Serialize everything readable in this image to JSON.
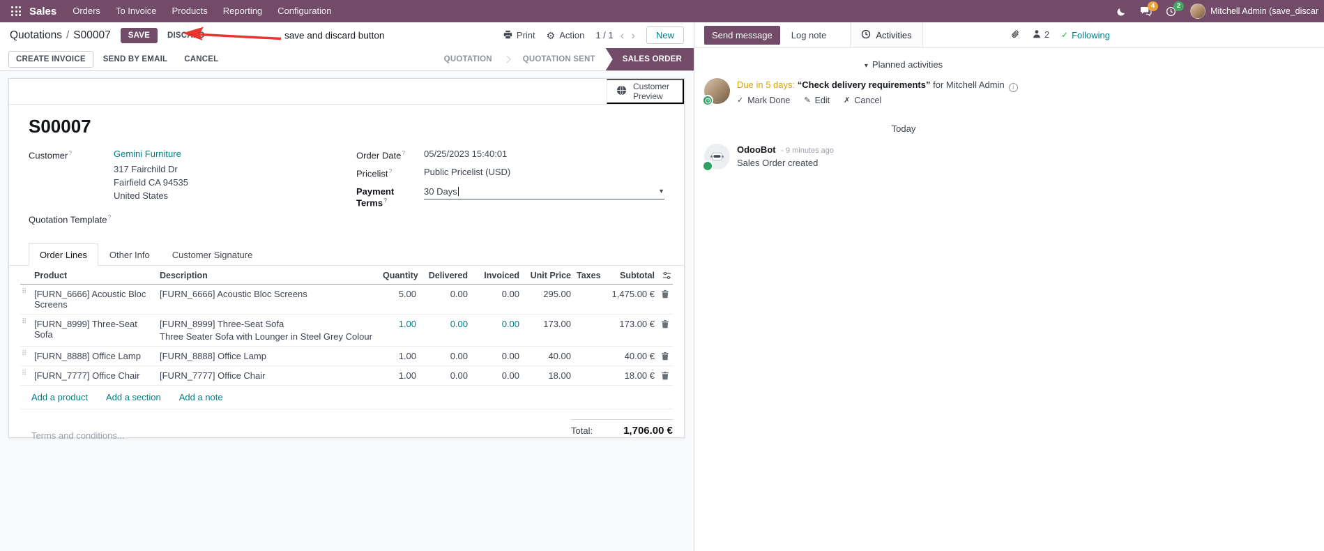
{
  "topbar": {
    "app": "Sales",
    "menus": [
      "Orders",
      "To Invoice",
      "Products",
      "Reporting",
      "Configuration"
    ],
    "message_badge": "4",
    "activity_badge": "2",
    "user_name": "Mitchell Admin (save_discar"
  },
  "control_panel": {
    "breadcrumb_parent": "Quotations",
    "breadcrumb_separator": "/",
    "breadcrumb_current": "S00007",
    "save": "SAVE",
    "discard": "DISCARD",
    "print": "Print",
    "action": "Action",
    "pager": "1 / 1",
    "new": "New"
  },
  "annotation": {
    "text": "save and discard button",
    "color": "#e8352e"
  },
  "statusbar": {
    "create_invoice": "CREATE INVOICE",
    "send_by_email": "SEND BY EMAIL",
    "cancel": "CANCEL",
    "stages": [
      "QUOTATION",
      "QUOTATION SENT",
      "SALES ORDER"
    ],
    "active_stage": "SALES ORDER"
  },
  "form": {
    "customer_preview": "Customer Preview",
    "name": "S00007",
    "customer_label": "Customer",
    "customer": "Gemini Furniture",
    "address": [
      "317 Fairchild Dr",
      "Fairfield CA 94535",
      "United States"
    ],
    "quotation_template_label": "Quotation Template",
    "order_date_label": "Order Date",
    "order_date": "05/25/2023 15:40:01",
    "pricelist_label": "Pricelist",
    "pricelist": "Public Pricelist (USD)",
    "payment_terms_label": "Payment Terms",
    "payment_terms": "30 Days",
    "tabs": [
      "Order Lines",
      "Other Info",
      "Customer Signature"
    ],
    "columns": [
      "Product",
      "Description",
      "Quantity",
      "Delivered",
      "Invoiced",
      "Unit Price",
      "Taxes",
      "Subtotal"
    ],
    "rows": [
      {
        "product": "[FURN_6666] Acoustic Bloc Screens",
        "desc1": "[FURN_6666] Acoustic Bloc Screens",
        "quantity": "5.00",
        "delivered": "0.00",
        "invoiced": "0.00",
        "unit_price": "295.00",
        "taxes": "",
        "subtotal": "1,475.00 €"
      },
      {
        "product": "[FURN_8999] Three-Seat Sofa",
        "desc1": "[FURN_8999] Three-Seat Sofa",
        "desc2": "Three Seater Sofa with Lounger in Steel Grey Colour",
        "quantity": "1.00",
        "delivered": "0.00",
        "invoiced": "0.00",
        "unit_price": "173.00",
        "taxes": "",
        "subtotal": "173.00 €"
      },
      {
        "product": "[FURN_8888] Office Lamp",
        "desc1": "[FURN_8888] Office Lamp",
        "quantity": "1.00",
        "delivered": "0.00",
        "invoiced": "0.00",
        "unit_price": "40.00",
        "taxes": "",
        "subtotal": "40.00 €"
      },
      {
        "product": "[FURN_7777] Office Chair",
        "desc1": "[FURN_7777] Office Chair",
        "quantity": "1.00",
        "delivered": "0.00",
        "invoiced": "0.00",
        "unit_price": "18.00",
        "taxes": "",
        "subtotal": "18.00 €"
      }
    ],
    "add_product": "Add a product",
    "add_section": "Add a section",
    "add_note": "Add a note",
    "terms_placeholder": "Terms and conditions...",
    "total_label": "Total:",
    "total_value": "1,706.00 €"
  },
  "chatter": {
    "send_message": "Send message",
    "log_note": "Log note",
    "activities_tab": "Activities",
    "followers_count": "2",
    "following": "Following",
    "planned_activities": "Planned activities",
    "activity": {
      "due": "Due in 5 days:",
      "summary": "“Check delivery requirements”",
      "assignee": "for Mitchell Admin",
      "mark_done": "Mark Done",
      "edit": "Edit",
      "cancel": "Cancel"
    },
    "date_divider": "Today",
    "message": {
      "author": "OdooBot",
      "time": "- 9 minutes ago",
      "body": "Sales Order created"
    }
  }
}
